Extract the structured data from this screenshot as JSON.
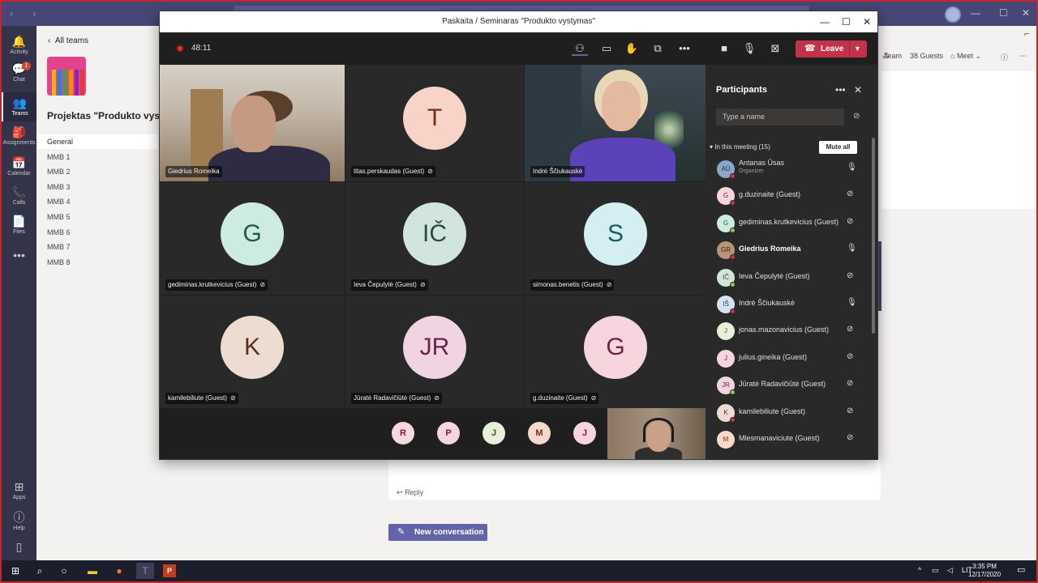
{
  "rail": {
    "items": [
      {
        "label": "Activity",
        "icon": "bell-icon",
        "glyph": "🔔"
      },
      {
        "label": "Chat",
        "icon": "chat-icon",
        "glyph": "💬",
        "badge": "1"
      },
      {
        "label": "Teams",
        "icon": "teams-icon",
        "glyph": "👥"
      },
      {
        "label": "Assignments",
        "icon": "assignments-icon",
        "glyph": "🎒"
      },
      {
        "label": "Calendar",
        "icon": "calendar-icon",
        "glyph": "📅"
      },
      {
        "label": "Calls",
        "icon": "phone-icon",
        "glyph": "📞"
      },
      {
        "label": "Files",
        "icon": "files-icon",
        "glyph": "📄"
      }
    ],
    "more": "•••",
    "apps_label": "Apps",
    "help_label": "Help"
  },
  "teams_panel": {
    "back_label": "All teams",
    "team_name": "Projektas \"Produkto vyst",
    "channels": [
      "General",
      "MMB 1",
      "MMB 2",
      "MMB 3",
      "MMB 4",
      "MMB 5",
      "MMB 6",
      "MMB 7",
      "MMB 8"
    ]
  },
  "channel": {
    "team_label": "Team",
    "guests_label": "38 Guests",
    "meet_label": "Meet",
    "reply_label": "Reply",
    "new_conversation_label": "New conversation"
  },
  "meeting": {
    "title": "Paskaita / Seminaras \"Produkto vystymas\"",
    "timer": "48:11",
    "leave_label": "Leave",
    "tiles": [
      {
        "name": "Giedrius Romeika",
        "type": "video",
        "muted": false
      },
      {
        "name": "titas.perskaudas (Guest)",
        "initials": "T",
        "bg": "#f8d3c7",
        "fg": "#7a2a1b",
        "muted": true
      },
      {
        "name": "Indrė Ščiukauskė",
        "type": "video",
        "muted": false
      },
      {
        "name": "gediminas.krutkevicius (Guest)",
        "initials": "G",
        "bg": "#cdecdf",
        "fg": "#1d5b43",
        "muted": true
      },
      {
        "name": "Ieva Čepulytė (Guest)",
        "initials": "IČ",
        "bg": "#d1e5dc",
        "fg": "#2c4a3e",
        "muted": true
      },
      {
        "name": "simonas.benetis (Guest)",
        "initials": "S",
        "bg": "#d5eef2",
        "fg": "#1d5a63",
        "muted": true
      },
      {
        "name": "kamilebiliute (Guest)",
        "initials": "K",
        "bg": "#ecdcd2",
        "fg": "#5a2f1d",
        "muted": true
      },
      {
        "name": "Jūratė Radavičiūtė (Guest)",
        "initials": "JR",
        "bg": "#f1d4e2",
        "fg": "#6b2348",
        "muted": true
      },
      {
        "name": "g.duzinaite (Guest)",
        "initials": "G",
        "bg": "#f7d5de",
        "fg": "#7b1e3a",
        "muted": true
      }
    ],
    "strip": [
      {
        "initials": "R",
        "bg": "#f5d9dd",
        "fg": "#7b1e3a"
      },
      {
        "initials": "P",
        "bg": "#f7d5de",
        "fg": "#7b1e3a"
      },
      {
        "initials": "J",
        "bg": "#e7f1d9",
        "fg": "#3d5c22"
      },
      {
        "initials": "M",
        "bg": "#f8d8cb",
        "fg": "#7a2a1b"
      },
      {
        "initials": "J",
        "bg": "#f7d5de",
        "fg": "#7b1e3a"
      }
    ]
  },
  "participants": {
    "title": "Participants",
    "search_placeholder": "Type a name",
    "section_label": "In this meeting (15)",
    "mute_all_label": "Mute all",
    "list": [
      {
        "name": "Antanas Ūsas",
        "role": "Organizer",
        "initials": "AŪ",
        "bg": "#8aa7c9",
        "fg": "#1b3553",
        "status": "#c4314b",
        "muted": false,
        "bold": false
      },
      {
        "name": "g.duzinaite (Guest)",
        "initials": "G",
        "bg": "#f7d5de",
        "fg": "#7b1e3a",
        "status": "#c4314b",
        "muted": true,
        "bold": false
      },
      {
        "name": "gediminas.krutkevicius (Guest)",
        "initials": "G",
        "bg": "#cdecdf",
        "fg": "#1d5b43",
        "status": "#92c353",
        "muted": true,
        "bold": false
      },
      {
        "name": "Giedrius Romeika",
        "initials": "GR",
        "bg": "#b89378",
        "fg": "#3b2414",
        "status": "#c4314b",
        "muted": false,
        "bold": true
      },
      {
        "name": "Ieva Čepulytė (Guest)",
        "initials": "IČ",
        "bg": "#d1e5dc",
        "fg": "#2c4a3e",
        "status": "#92c353",
        "muted": true,
        "bold": false
      },
      {
        "name": "Indrė Ščiukauskė",
        "initials": "IŠ",
        "bg": "#d5e3f1",
        "fg": "#23456b",
        "status": "#c4314b",
        "muted": false,
        "bold": false
      },
      {
        "name": "jonas.mazonavicius (Guest)",
        "initials": "J",
        "bg": "#e7f1d9",
        "fg": "#3d5c22",
        "status": "",
        "muted": true,
        "bold": false
      },
      {
        "name": "julius.gineika (Guest)",
        "initials": "J",
        "bg": "#f7d5de",
        "fg": "#7b1e3a",
        "status": "",
        "muted": true,
        "bold": false
      },
      {
        "name": "Jūratė Radavičiūtė (Guest)",
        "initials": "JR",
        "bg": "#f1d4e2",
        "fg": "#6b2348",
        "status": "#92c353",
        "muted": true,
        "bold": false
      },
      {
        "name": "kamilebiliute (Guest)",
        "initials": "K",
        "bg": "#ecdcd2",
        "fg": "#5a2f1d",
        "status": "#c4314b",
        "muted": true,
        "bold": false
      },
      {
        "name": "Mlesmanaviciute (Guest)",
        "initials": "M",
        "bg": "#f8d8cb",
        "fg": "#7a2a1b",
        "status": "",
        "muted": true,
        "bold": false
      }
    ]
  },
  "taskbar": {
    "lang": "LIT",
    "time": "3:35 PM",
    "date": "12/17/2020"
  },
  "colors": {
    "teams_purple": "#464775",
    "accent": "#6264a7",
    "leave_red": "#c4314b"
  }
}
